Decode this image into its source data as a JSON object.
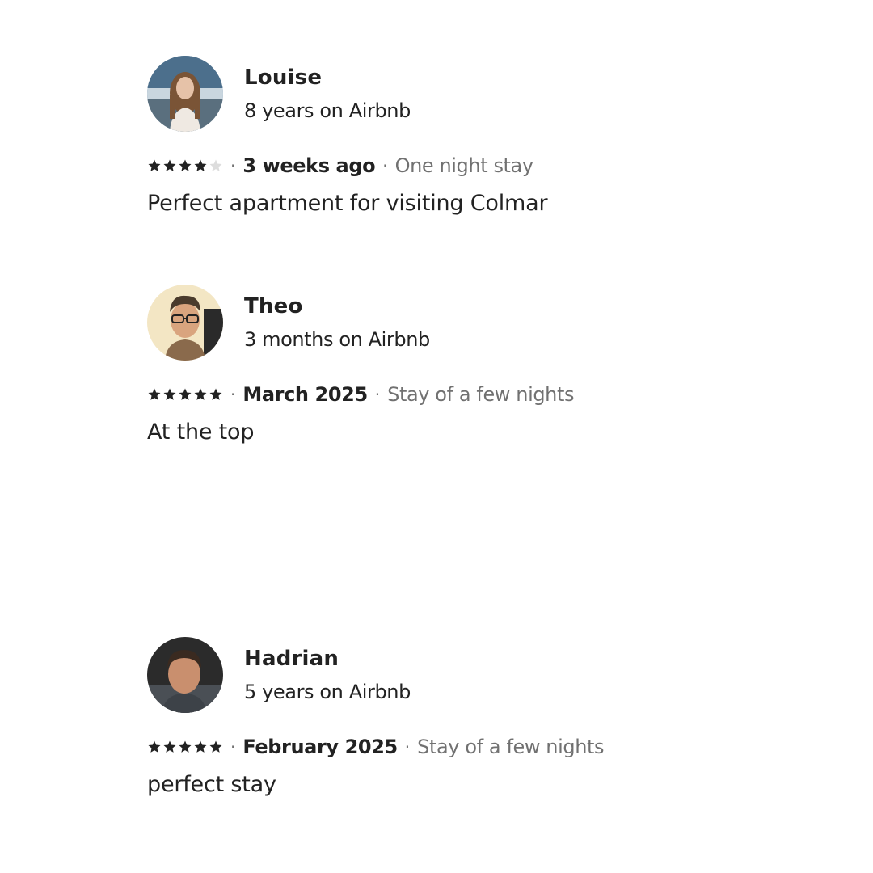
{
  "reviews": [
    {
      "name": "Louise",
      "tenure": "8 years on Airbnb",
      "rating": 4,
      "date": "3 weeks ago",
      "stay_type": "One night stay",
      "text": "Perfect apartment for visiting Colmar",
      "avatar_icon": "profile-photo-woman"
    },
    {
      "name": "Theo",
      "tenure": "3 months on Airbnb",
      "rating": 5,
      "date": "March 2025",
      "stay_type": "Stay of a few nights",
      "text": "At the top",
      "avatar_icon": "profile-photo-man-glasses"
    },
    {
      "name": "Hadrian",
      "tenure": "5 years on Airbnb",
      "rating": 5,
      "date": "February 2025",
      "stay_type": "Stay of a few nights",
      "text": "perfect stay",
      "avatar_icon": "profile-photo-man"
    }
  ],
  "separator": "·",
  "colors": {
    "text_primary": "#222222",
    "text_secondary": "#717171",
    "star_filled": "#222222",
    "star_empty": "#dddddd"
  }
}
